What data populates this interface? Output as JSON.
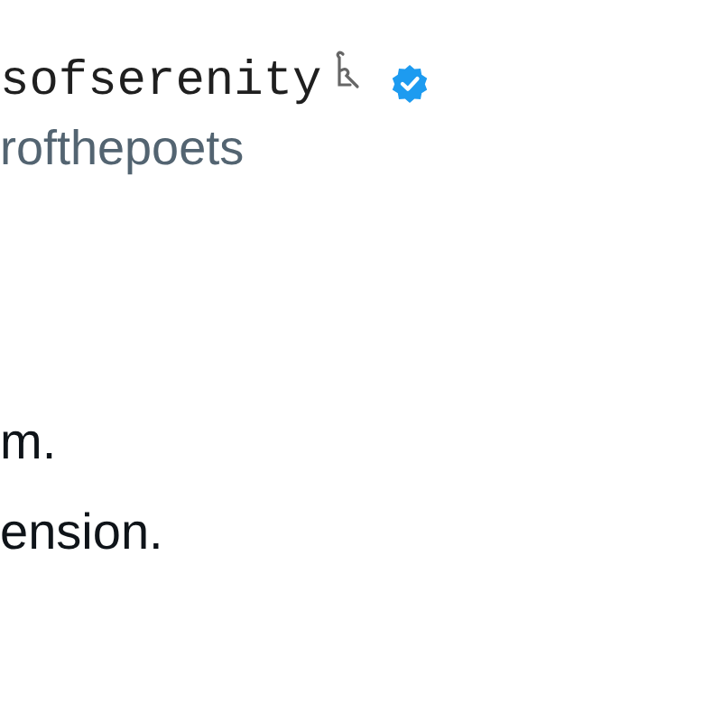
{
  "author": {
    "display_name": "sofserenity",
    "verified": true,
    "handle": "rofthepoets"
  },
  "body": [
    "m.",
    "ension."
  ]
}
